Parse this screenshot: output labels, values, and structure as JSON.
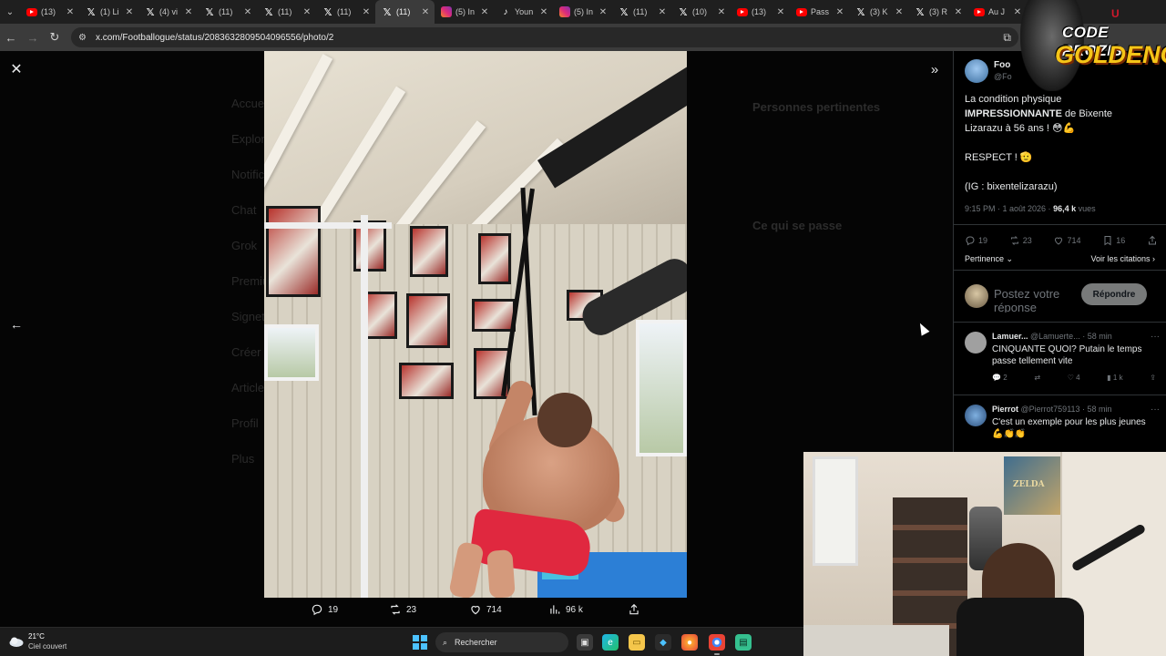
{
  "browser": {
    "tabs": [
      {
        "icon": "youtube",
        "label": "(13)"
      },
      {
        "icon": "x",
        "label": "(1) Li"
      },
      {
        "icon": "x",
        "label": "(4) vi"
      },
      {
        "icon": "x",
        "label": "(11)"
      },
      {
        "icon": "x",
        "label": "(11)"
      },
      {
        "icon": "x",
        "label": "(11)"
      },
      {
        "icon": "x",
        "label": "(11)"
      },
      {
        "icon": "instagram",
        "label": "(5) In"
      },
      {
        "icon": "tiktok",
        "label": "Youn"
      },
      {
        "icon": "instagram",
        "label": "(5) In"
      },
      {
        "icon": "x",
        "label": "(11)"
      },
      {
        "icon": "x",
        "label": "(10)"
      },
      {
        "icon": "youtube",
        "label": "(13)"
      },
      {
        "icon": "youtube",
        "label": "Pass"
      },
      {
        "icon": "x",
        "label": "(3) K"
      },
      {
        "icon": "x",
        "label": "(3) R"
      },
      {
        "icon": "youtube",
        "label": "Au J"
      }
    ],
    "active_tab": 6,
    "url": "x.com/Footballogue/status/2083632809504096556/photo/2"
  },
  "viewer": {
    "close_label": "✕",
    "prev_label": "←",
    "collapse_label": "»",
    "actions": {
      "replies": "19",
      "reposts": "23",
      "likes": "714",
      "views": "96 k"
    }
  },
  "ghost_sidebar": [
    "Accueil",
    "Explorer",
    "Notifications",
    "Chat",
    "Grok",
    "Premium",
    "Signets",
    "Créer",
    "Articles",
    "Profil",
    "Plus"
  ],
  "ghost_right": {
    "relevant_title": "Personnes pertinentes",
    "happening_title": "Ce qui se passe"
  },
  "post": {
    "author_name": "Foo",
    "author_handle": "@Fo",
    "text_line1_pre": "La condition physique",
    "text_strong": "IMPRESSIONNANTE",
    "text_line2_post": "de Bixente Lizarazu à 56 ans ! 😳💪",
    "text_respect": "RESPECT ! 🫡",
    "text_ig": "(IG : bixentelizarazu)",
    "time": "9:15 PM · 1 août 2026 · ",
    "views_count": "96,4 k",
    "views_label": " vues",
    "stats": {
      "replies": "19",
      "reposts": "23",
      "likes": "714",
      "bookmarks": "16"
    },
    "sort_label": "Pertinence",
    "quotes_label": "Voir les citations"
  },
  "reply": {
    "placeholder": "Postez votre réponse",
    "button": "Répondre"
  },
  "comments": [
    {
      "name": "Lamuer...",
      "handle": "@Lamuerte...",
      "time": " · 58 min",
      "text": "CINQUANTE QUOI? Putain le temps passe tellement vite",
      "replies": "2",
      "reposts": "",
      "likes": "4",
      "views": "1 k"
    },
    {
      "name": "Pierrot",
      "handle": "@Pierrot759113",
      "time": " · 58 min",
      "text": "C'est un exemple pour les plus jeunes 💪👏👏",
      "replies": "",
      "reposts": "",
      "likes": "",
      "views": ""
    }
  ],
  "overlay": {
    "logo_line1": "CODE PROZIS",
    "logo_line2": "GOLDENG",
    "logo_top": "U",
    "poster_text": "ZELDA"
  },
  "taskbar": {
    "temperature": "21°C",
    "weather": "Ciel couvert",
    "search_label": "Rechercher"
  },
  "colors": {
    "accent_start": "#4cc2ff",
    "reply_button_bg": "#787a7a",
    "logo_gold": "#f5c518"
  }
}
